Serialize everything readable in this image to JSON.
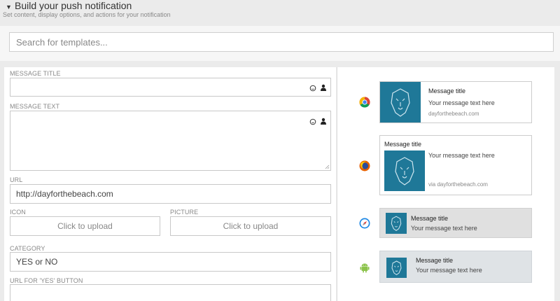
{
  "header": {
    "title": "Build your push notification",
    "subtitle": "Set content, display options, and actions for your notification"
  },
  "search": {
    "placeholder": "Search for templates..."
  },
  "form": {
    "message_title_label": "MESSAGE TITLE",
    "message_text_label": "MESSAGE TEXT",
    "url_label": "URL",
    "url_value": "http://dayforthebeach.com",
    "icon_label": "ICON",
    "icon_upload": "Click to upload",
    "picture_label": "PICTURE",
    "picture_upload": "Click to upload",
    "category_label": "CATEGORY",
    "category_value": "YES or NO",
    "yes_url_label": "URL FOR 'YES' BUTTON"
  },
  "previews": {
    "chrome": {
      "title": "Message title",
      "text": "Your message text here",
      "site": "dayforthebeach.com"
    },
    "firefox": {
      "title": "Message title",
      "text": "Your message text here",
      "site": "via dayforthebeach.com"
    },
    "safari": {
      "title": "Message title",
      "text": "Your message text here"
    },
    "android": {
      "title": "Message title",
      "text": "Your message text here"
    }
  },
  "colors": {
    "thumb": "#1f7898",
    "accent_text": "#444444"
  },
  "icons": [
    "caret-down-icon",
    "emoji-icon",
    "person-icon",
    "chrome-icon",
    "firefox-icon",
    "safari-icon",
    "android-icon",
    "lion-logo-icon"
  ]
}
